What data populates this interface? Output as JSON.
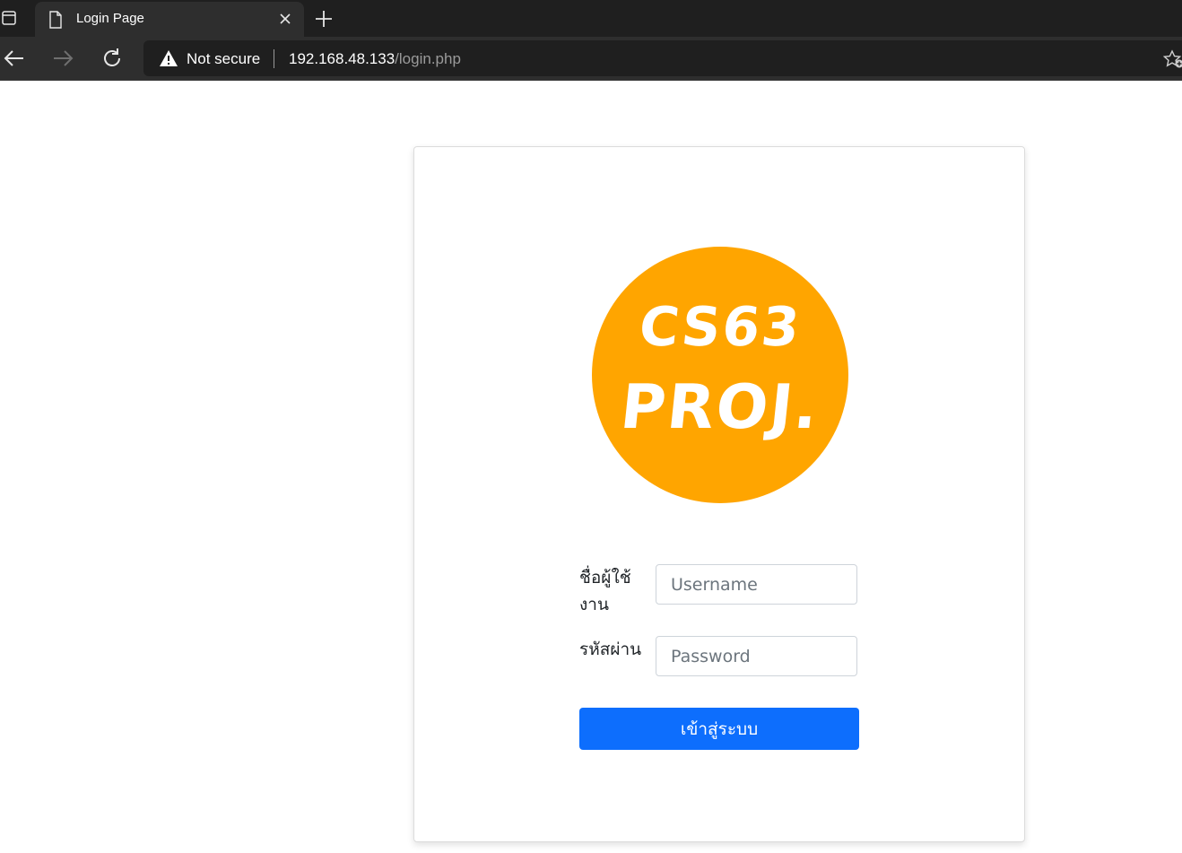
{
  "browser": {
    "tab": {
      "title": "Login Page"
    },
    "address": {
      "security_label": "Not secure",
      "url_host": "192.168.48.133",
      "url_path": "/login.php"
    },
    "icons": {
      "tab_actions": "tab-actions-icon",
      "page": "document-icon",
      "close": "close-icon",
      "new_tab": "plus-icon",
      "back": "back-arrow-icon",
      "forward": "forward-arrow-icon",
      "refresh": "refresh-icon",
      "warning": "warning-triangle-icon",
      "favorite": "add-favorite-icon"
    }
  },
  "login": {
    "logo": {
      "line1": "CS63",
      "line2": "PROJ.",
      "color": "#ffa500"
    },
    "username": {
      "label": "ชื่อผู้ใช้งาน",
      "placeholder": "Username",
      "value": ""
    },
    "password": {
      "label": "รหัสผ่าน",
      "placeholder": "Password",
      "value": ""
    },
    "submit_label": "เข้าสู่ระบบ",
    "colors": {
      "button": "#0d6efd"
    }
  }
}
